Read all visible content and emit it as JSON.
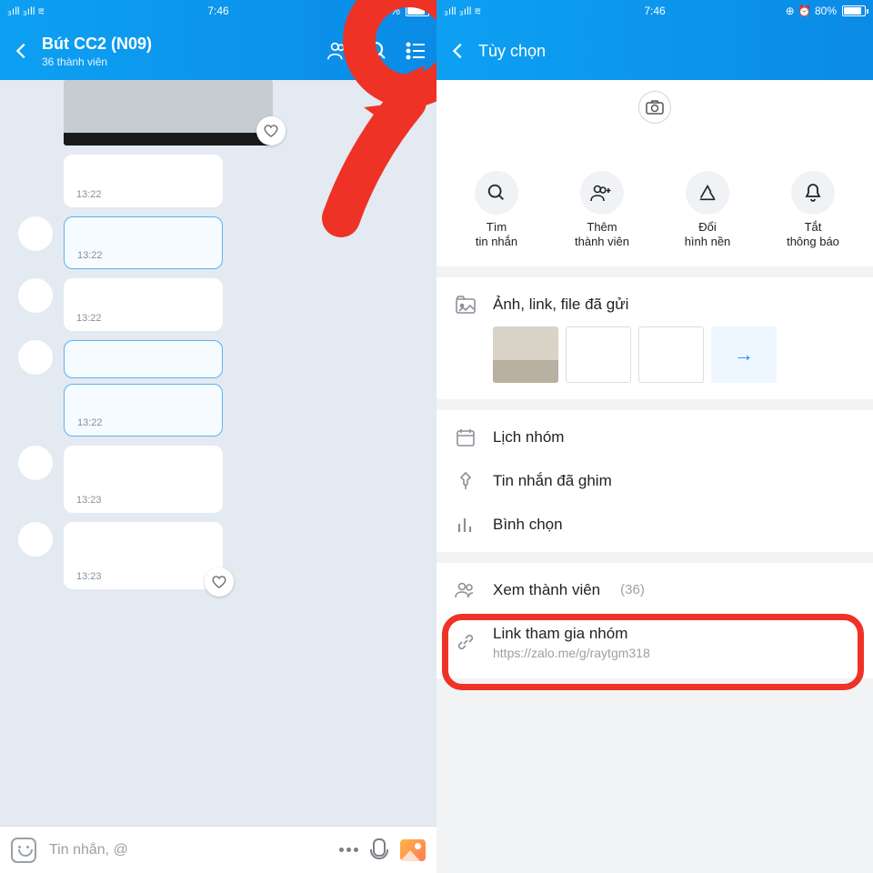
{
  "status": {
    "time": "7:46",
    "battery": "80%",
    "net": "3G"
  },
  "left": {
    "title": "Bút CC2 (N09)",
    "subtitle": "36 thành viên",
    "msgs": [
      {
        "time": "13:22",
        "blue": false,
        "avatar": false
      },
      {
        "time": "13:22",
        "blue": true,
        "avatar": true
      },
      {
        "time": "13:22",
        "blue": false,
        "avatar": true
      },
      {
        "time": "",
        "blue": true,
        "avatar": true
      },
      {
        "time": "13:22",
        "blue": true,
        "avatar": false
      },
      {
        "time": "13:23",
        "blue": false,
        "avatar": true
      },
      {
        "time": "13:23",
        "blue": false,
        "avatar": true
      }
    ],
    "input_placeholder": "Tin nhắn, @"
  },
  "right": {
    "title": "Tùy chọn",
    "actions": [
      {
        "label": "Tìm\ntin nhắn"
      },
      {
        "label": "Thêm\nthành viên"
      },
      {
        "label": "Đổi\nhình nền"
      },
      {
        "label": "Tắt\nthông báo"
      }
    ],
    "media_label": "Ảnh, link, file đã gửi",
    "calendar": "Lịch nhóm",
    "pinned": "Tin nhắn đã ghim",
    "poll": "Bình chọn",
    "members_label": "Xem thành viên",
    "members_count": "(36)",
    "link_label": "Link tham gia nhóm",
    "link_url": "https://zalo.me/g/raytgm318"
  }
}
